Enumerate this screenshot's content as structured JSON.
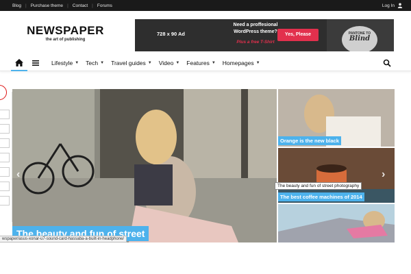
{
  "topbar": {
    "links": [
      "Blog",
      "Purchase theme",
      "Contact",
      "Forums"
    ],
    "login": "Log In"
  },
  "logo": {
    "title": "NEWSPAPER",
    "tagline": "the art of publishing"
  },
  "ad": {
    "size": "728 x 90 Ad",
    "headline_line1": "Need a proffesional",
    "headline_line2": "WordPress theme?",
    "tshirt": "Plus a free T-Shirt",
    "cta": "Yes, Please",
    "shirt_text_top": "PANTONE TO",
    "shirt_text_big": "Blind"
  },
  "nav": {
    "items": [
      {
        "label": "Lifestyle"
      },
      {
        "label": "Tech"
      },
      {
        "label": "Travel guides"
      },
      {
        "label": "Video"
      },
      {
        "label": "Features"
      },
      {
        "label": "Homepages"
      }
    ]
  },
  "slider": {
    "main_caption": "The beauty and fun of street",
    "tiles": [
      {
        "caption": "Orange is the new black"
      },
      {
        "caption": "The best coffee machines of 2014"
      },
      {
        "caption": ""
      }
    ]
  },
  "tooltip": "The beauty and fun of street photography",
  "status_url": "wspaper/asus-xonar-u7-sound-card-hassaba-a-built-in-headphone/",
  "colors": {
    "accent": "#4db2ec",
    "cta": "#e2304d",
    "topbar": "#1a1a1a"
  }
}
